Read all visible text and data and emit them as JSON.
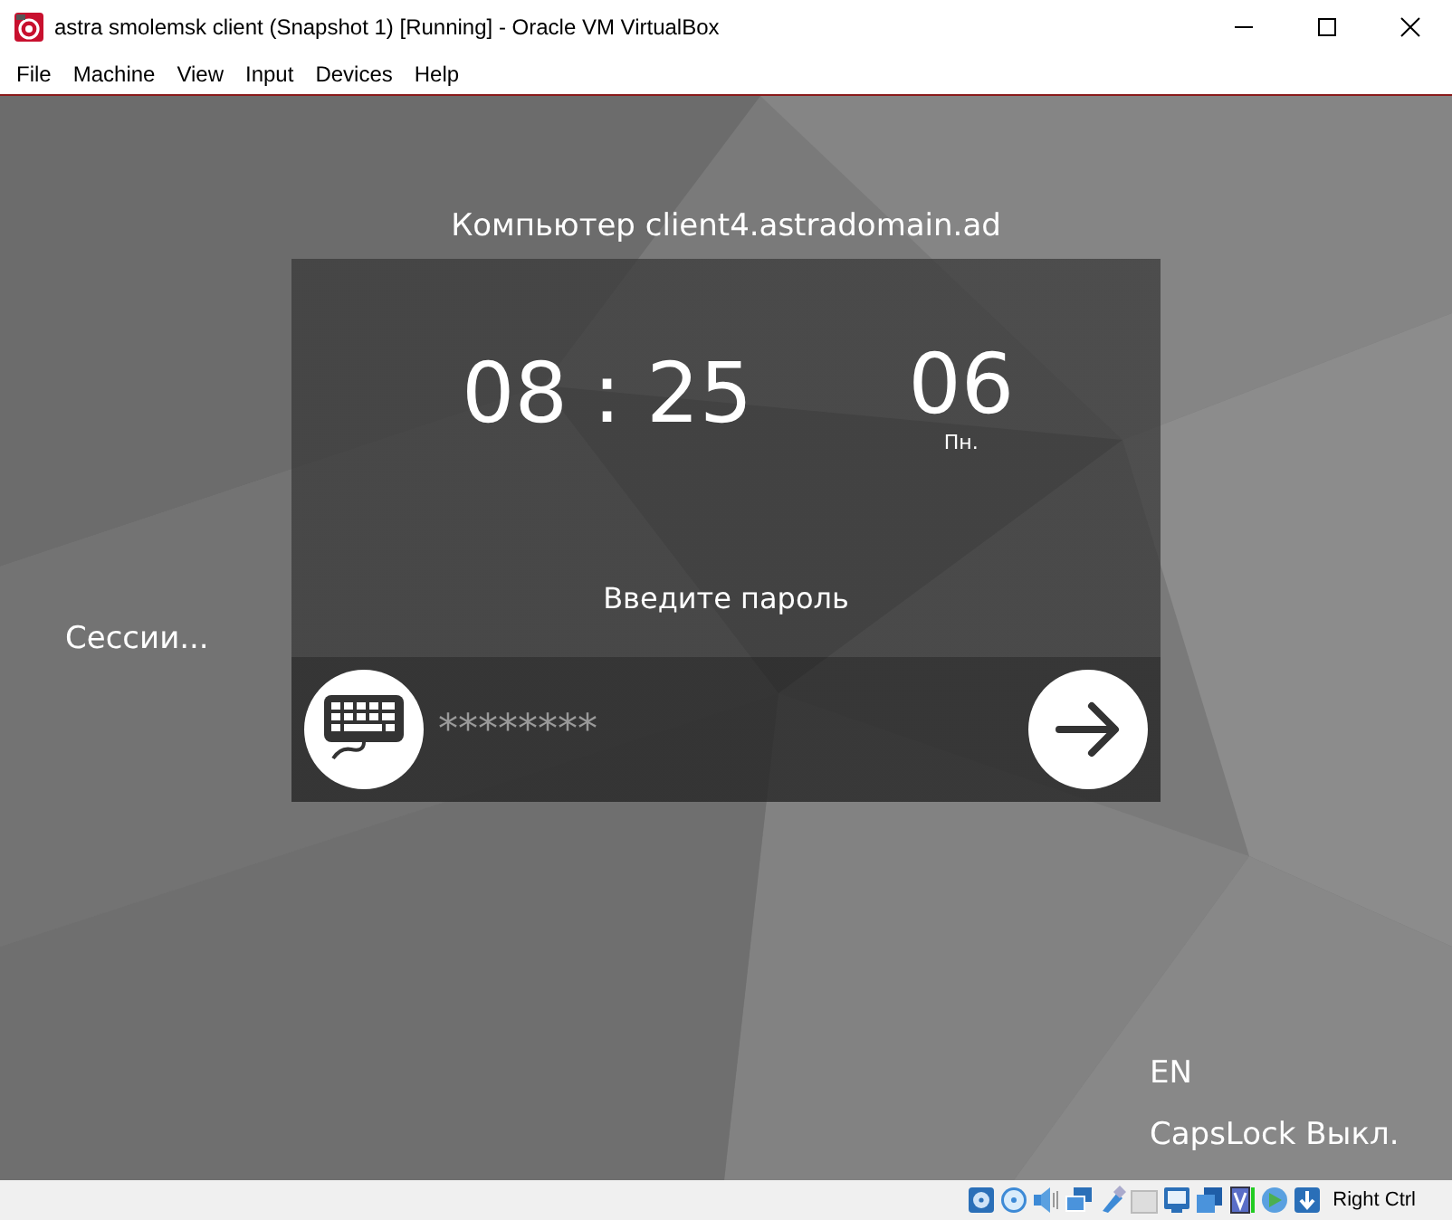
{
  "window": {
    "title": "astra smolemsk client (Snapshot 1) [Running] - Oracle VM VirtualBox"
  },
  "menu": [
    "File",
    "Machine",
    "View",
    "Input",
    "Devices",
    "Help"
  ],
  "login": {
    "computer": "Компьютер client4.astradomain.ad",
    "clock": {
      "hours": "08",
      "separator": ":",
      "minutes": "25"
    },
    "date": {
      "day": "06",
      "weekday": "Пн."
    },
    "prompt": "Введите пароль",
    "password": {
      "value": "********"
    },
    "sessions": "Сессии...",
    "layout": "EN",
    "capslock": "CapsLock Выкл."
  },
  "status_bar": {
    "host_key": "Right Ctrl"
  }
}
